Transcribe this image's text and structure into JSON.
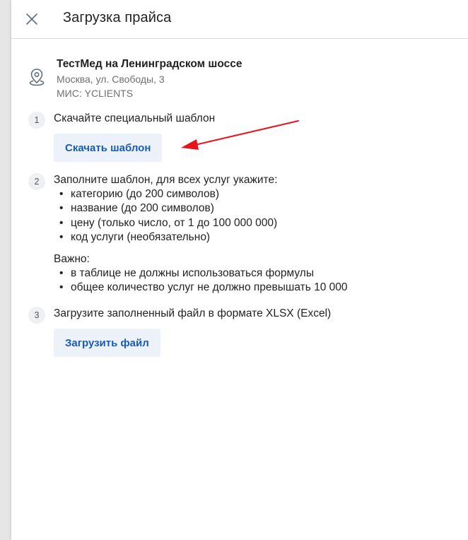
{
  "header": {
    "title": "Загрузка прайса"
  },
  "clinic": {
    "name": "ТестМед на Ленинградском шоссе",
    "address": "Москва, ул. Свободы, 3",
    "mis": "МИС: YCLIENTS"
  },
  "steps": [
    {
      "number": "1",
      "text": "Скачайте специальный шаблон",
      "button_label": "Скачать шаблон"
    },
    {
      "number": "2",
      "text": "Заполните шаблон, для всех услуг укажите:",
      "items": [
        "категорию (до 200 символов)",
        "название (до 200 символов)",
        "цену (только число, от 1 до 100 000 000)",
        "код услуги (необязательно)"
      ],
      "important_label": "Важно:",
      "important_items": [
        "в таблице не должны использоваться формулы",
        "общее количество услуг не должно превышать 10 000"
      ]
    },
    {
      "number": "3",
      "text": "Загрузите заполненный файл в формате XLSX (Excel)",
      "button_label": "Загрузить файл"
    }
  ],
  "colors": {
    "accent": "#1a5bb5",
    "button_bg": "#edf2fa",
    "annotation_arrow": "#e8141c"
  },
  "icons": {
    "close": "close-icon",
    "location": "location-pin-icon"
  }
}
